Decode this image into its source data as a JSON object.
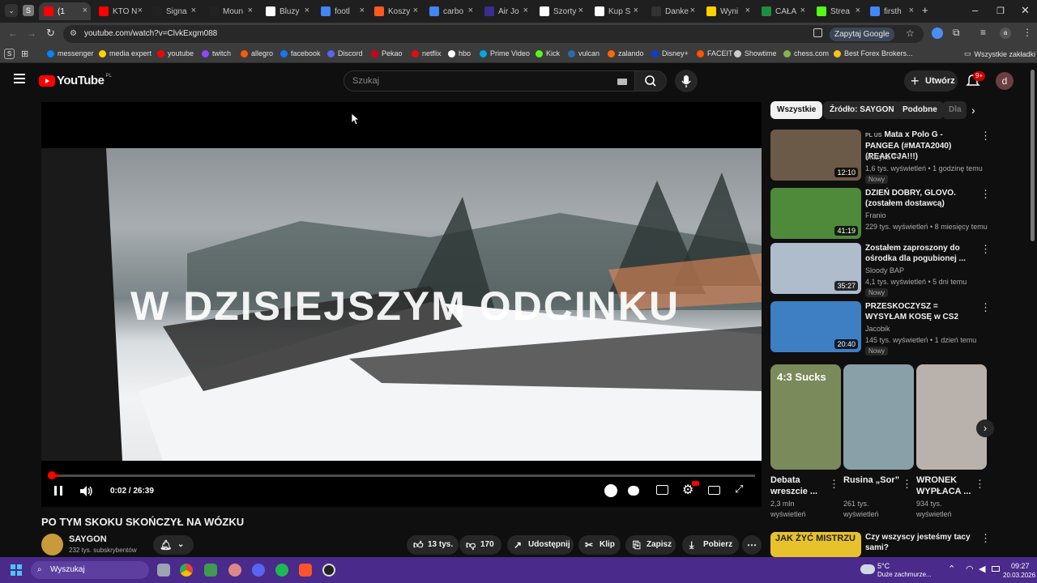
{
  "browser": {
    "tabs": [
      {
        "label": "(1",
        "color": "#ff0000"
      },
      {
        "label": "KTO N",
        "color": "#ff0000"
      },
      {
        "label": "Signa",
        "color": "#222222"
      },
      {
        "label": "Moun",
        "color": "#222222"
      },
      {
        "label": "Bluzy",
        "color": "#ffffff"
      },
      {
        "label": "footl",
        "color": "#4285f4"
      },
      {
        "label": "Koszy",
        "color": "#ff5a1f"
      },
      {
        "label": "carbo",
        "color": "#4285f4"
      },
      {
        "label": "Air Jo",
        "color": "#3b2d8f"
      },
      {
        "label": "Szorty",
        "color": "#ffffff"
      },
      {
        "label": "Kup S",
        "color": "#ffffff"
      },
      {
        "label": "Danke",
        "color": "#333333"
      },
      {
        "label": "Wyni",
        "color": "#ffd200"
      },
      {
        "label": "CAŁA",
        "color": "#1e8e3e"
      },
      {
        "label": "Strea",
        "color": "#53fc18"
      },
      {
        "label": "firsth",
        "color": "#4285f4"
      }
    ],
    "url": "youtube.com/watch?v=ClvkExgm088",
    "ask_google": "Zapytaj Google",
    "bookmarks": [
      {
        "label": "messenger",
        "color": "#0084ff"
      },
      {
        "label": "media expert",
        "color": "#ffd200"
      },
      {
        "label": "youtube",
        "color": "#ff0000"
      },
      {
        "label": "twitch",
        "color": "#9146ff"
      },
      {
        "label": "allegro",
        "color": "#ff5a00"
      },
      {
        "label": "facebook",
        "color": "#1877f2"
      },
      {
        "label": "Discord",
        "color": "#5865f2"
      },
      {
        "label": "Pekao",
        "color": "#d0021b"
      },
      {
        "label": "netflix",
        "color": "#e50914"
      },
      {
        "label": "hbo",
        "color": "#ffffff"
      },
      {
        "label": "Prime Video",
        "color": "#00a8e1"
      },
      {
        "label": "Kick",
        "color": "#53fc18"
      },
      {
        "label": "vulcan",
        "color": "#2b6cb0"
      },
      {
        "label": "zalando",
        "color": "#ff6900"
      },
      {
        "label": "Disney+",
        "color": "#113ccf"
      },
      {
        "label": "FACEIT",
        "color": "#ff5500"
      },
      {
        "label": "Showtime",
        "color": "#cccccc"
      },
      {
        "label": "chess.com",
        "color": "#81b64c"
      },
      {
        "label": "Best Forex Brokers...",
        "color": "#f5c518"
      }
    ],
    "all_bookmarks": "Wszystkie zakładki"
  },
  "youtube": {
    "logo_text": "YouTube",
    "logo_region": "PL",
    "search_placeholder": "Szukaj",
    "create_label": "Utwórz",
    "notifications_badge": "9+",
    "avatar_letter": "d"
  },
  "player": {
    "overlay_text": "W DZISIEJSZYM ODCINKU",
    "time": "0:02 / 26:39",
    "progress_fraction": 0.0013
  },
  "video": {
    "title": "PO TYM SKOKU SKOŃCZYŁ NA WÓZKU",
    "channel": "SAYGON",
    "subscribers": "232 tys. subskrybentów",
    "likes": "13 tys.",
    "dislikes": "170",
    "share": "Udostępnij",
    "clip": "Klip",
    "save": "Zapisz",
    "download": "Pobierz"
  },
  "chips": [
    "Wszystkie",
    "Źródło: SAYGON",
    "Podobne",
    "Dla"
  ],
  "recommendations": [
    {
      "prefix": "PL US",
      "title": "Mata x Polo G - PANGEA (#MATA2040) (REAKCJA!!!)",
      "channel": "Muzyka TV",
      "meta": "1,6 tys. wyświetleń • 1 godzinę temu",
      "badge": "Nowy",
      "duration": "12:10",
      "color": "#6b5a48"
    },
    {
      "prefix": "",
      "title": "DZIEŃ DOBRY, GLOVO. (zostałem dostawcą)",
      "channel": "Franio",
      "meta": "229 tys. wyświetleń • 8 miesięcy temu",
      "badge": "",
      "duration": "41:19",
      "color": "#4f8a3a"
    },
    {
      "prefix": "",
      "title": "Zostałem zaproszony do ośrodka dla pogubionej ...",
      "channel": "Sloody BAP",
      "meta": "4,1 tys. wyświetleń • 5 dni temu",
      "badge": "Nowy",
      "duration": "35:27",
      "color": "#aebccc"
    },
    {
      "prefix": "",
      "title": "PRZESKOCZYSZ = WYSYŁAM KOSĘ w CS2",
      "channel": "Jacobik",
      "meta": "145 tys. wyświetleń • 1 dzień temu",
      "badge": "Nowy",
      "duration": "20:40",
      "color": "#3e7fc4"
    }
  ],
  "shorts": [
    {
      "title": "Debata wreszcie ...",
      "views": "2,3 mln wyświetleń",
      "label": "4:3 Sucks",
      "color": "#7a8a5a"
    },
    {
      "title": "Rusina „Sor”",
      "views": "261 tys. wyświetleń",
      "label": "",
      "color": "#8aa0a8"
    },
    {
      "title": "WRONEK WYPŁACA ...",
      "views": "934 tys. wyświetleń",
      "label": "",
      "color": "#b9b2ac"
    }
  ],
  "bottom_rec": {
    "title": "Czy wszyscy jesteśmy tacy sami?",
    "thumb_text": "JAK ŻYĆ MISTRZU"
  },
  "taskbar": {
    "search_placeholder": "Wyszukaj",
    "weather_temp": "5°C",
    "weather_desc": "Duże zachmurze...",
    "time": "09:27",
    "date": "20.03.2026"
  }
}
